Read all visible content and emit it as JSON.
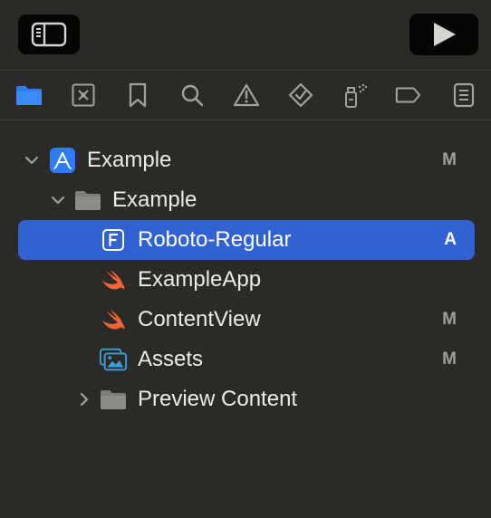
{
  "toolbar": {
    "left_button_icon": "sidebar-toggle-icon",
    "right_button_icon": "play-icon"
  },
  "navigator_tabs": [
    {
      "icon": "folder-icon",
      "active": true
    },
    {
      "icon": "source-control-icon",
      "active": false
    },
    {
      "icon": "bookmark-icon",
      "active": false
    },
    {
      "icon": "search-icon",
      "active": false
    },
    {
      "icon": "warning-icon",
      "active": false
    },
    {
      "icon": "test-diamond-icon",
      "active": false
    },
    {
      "icon": "debug-spray-icon",
      "active": false
    },
    {
      "icon": "tag-icon",
      "active": false
    },
    {
      "icon": "report-list-icon",
      "active": false
    }
  ],
  "tree": {
    "items": [
      {
        "label": "Example",
        "badge": "M",
        "icon": "app-project-icon",
        "expanded": true,
        "selected": false
      },
      {
        "label": "Example",
        "badge": "",
        "icon": "folder-icon",
        "expanded": true,
        "selected": false
      },
      {
        "label": "Roboto-Regular",
        "badge": "A",
        "icon": "font-file-icon",
        "selected": true
      },
      {
        "label": "ExampleApp",
        "badge": "",
        "icon": "swift-icon",
        "selected": false
      },
      {
        "label": "ContentView",
        "badge": "M",
        "icon": "swift-icon",
        "selected": false
      },
      {
        "label": "Assets",
        "badge": "M",
        "icon": "assets-icon",
        "selected": false
      },
      {
        "label": "Preview Content",
        "badge": "",
        "icon": "folder-icon",
        "expanded": false,
        "selected": false
      }
    ]
  },
  "colors": {
    "background": "#2b2a27",
    "selection": "#3262d2",
    "accent": "#2f7df6",
    "swift_orange": "#f0643a"
  }
}
